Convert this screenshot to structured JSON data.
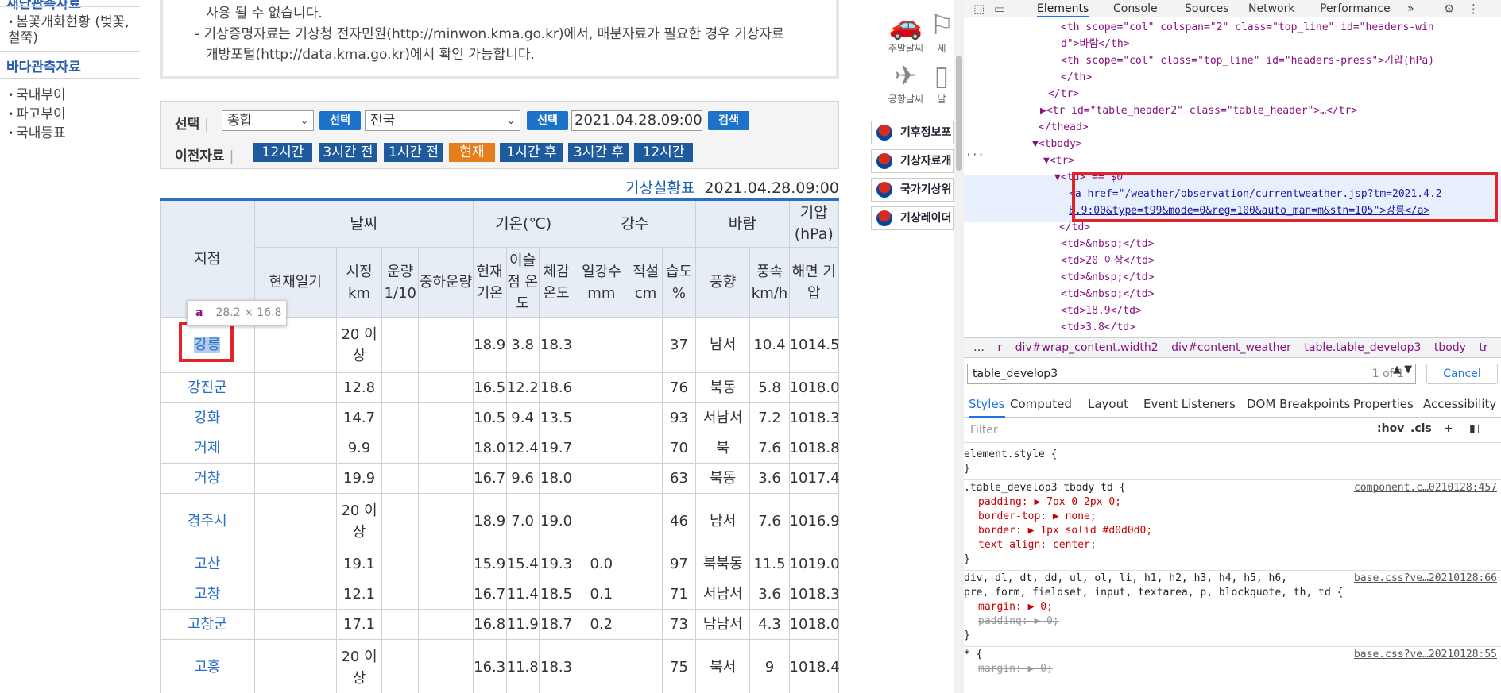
{
  "sidebar": {
    "cut_header": "재난관측자료",
    "items_top": [
      {
        "label": "봄꽃개화현황 (벚꽃, 철쭉)"
      }
    ],
    "section_header": "바다관측자료",
    "items": [
      {
        "label": "국내부이"
      },
      {
        "label": "파고부이"
      },
      {
        "label": "국내등표"
      }
    ]
  },
  "notice": {
    "line1": "사용 될 수 없습니다.",
    "line2": "- 기상증명자료는 기상청 전자민원(http://minwon.kma.go.kr)에서, 매분자료가 필요한 경우 기상자료",
    "line3": "개방포털(http://data.kma.go.kr)에서 확인 가능합니다."
  },
  "selector": {
    "label_select": "선택",
    "label_prev": "이전자료",
    "type_value": "종합",
    "region_value": "전국",
    "select_button": "선택",
    "datetime_value": "2021.04.28.09:00",
    "search_button": "검색",
    "nav_buttons": [
      "12시간",
      "3시간 전",
      "1시간 전",
      "현재",
      "1시간 후",
      "3시간 후",
      "12시간"
    ]
  },
  "table": {
    "title": "기상실황표",
    "datetime": "2021.04.28.09:00",
    "headers": {
      "station": "지점",
      "weather": "날씨",
      "temp": "기온(℃)",
      "precip": "강수",
      "wind": "바람",
      "pressure": "기압(hPa)",
      "sub": [
        "현재일기",
        "시정 km",
        "운량 1/10",
        "중하운량",
        "현재 기온",
        "이슬점 온도",
        "체감 온도",
        "일강수 mm",
        "적설 cm",
        "습도 %",
        "풍향",
        "풍속 km/h",
        "해면 기압"
      ]
    },
    "rows": [
      {
        "station": "강릉",
        "cells": [
          "",
          "20 이상",
          "",
          "",
          "18.9",
          "3.8",
          "18.3",
          "",
          "",
          "37",
          "남서",
          "10.4",
          "1014.5"
        ]
      },
      {
        "station": "강진군",
        "cells": [
          "",
          "12.8",
          "",
          "",
          "16.5",
          "12.2",
          "18.6",
          "",
          "",
          "76",
          "북동",
          "5.8",
          "1018.0"
        ]
      },
      {
        "station": "강화",
        "cells": [
          "",
          "14.7",
          "",
          "",
          "10.5",
          "9.4",
          "13.5",
          "",
          "",
          "93",
          "서남서",
          "7.2",
          "1018.3"
        ]
      },
      {
        "station": "거제",
        "cells": [
          "",
          "9.9",
          "",
          "",
          "18.0",
          "12.4",
          "19.7",
          "",
          "",
          "70",
          "북",
          "7.6",
          "1018.8"
        ]
      },
      {
        "station": "거창",
        "cells": [
          "",
          "19.9",
          "",
          "",
          "16.7",
          "9.6",
          "18.0",
          "",
          "",
          "63",
          "북동",
          "3.6",
          "1017.4"
        ]
      },
      {
        "station": "경주시",
        "cells": [
          "",
          "20 이상",
          "",
          "",
          "18.9",
          "7.0",
          "19.0",
          "",
          "",
          "46",
          "남서",
          "7.6",
          "1016.9"
        ]
      },
      {
        "station": "고산",
        "cells": [
          "",
          "19.1",
          "",
          "",
          "15.9",
          "15.4",
          "19.3",
          "0.0",
          "",
          "97",
          "북북동",
          "11.5",
          "1019.0"
        ]
      },
      {
        "station": "고창",
        "cells": [
          "",
          "12.1",
          "",
          "",
          "16.7",
          "11.4",
          "18.5",
          "0.1",
          "",
          "71",
          "서남서",
          "3.6",
          "1018.3"
        ]
      },
      {
        "station": "고창군",
        "cells": [
          "",
          "17.1",
          "",
          "",
          "16.8",
          "11.9",
          "18.7",
          "0.2",
          "",
          "73",
          "남남서",
          "4.3",
          "1018.0"
        ]
      },
      {
        "station": "고흥",
        "cells": [
          "",
          "20 이상",
          "",
          "",
          "16.3",
          "11.8",
          "18.3",
          "",
          "",
          "75",
          "북서",
          "9",
          "1018.4"
        ]
      }
    ]
  },
  "tooltip": {
    "tag": "a",
    "size": "28.2 × 16.8"
  },
  "quicklinks": {
    "icons": [
      {
        "label": "주말날씨"
      },
      {
        "label": "세"
      },
      {
        "label": "공항날씨"
      },
      {
        "label": "날"
      }
    ],
    "bars": [
      {
        "label": "기후정보포"
      },
      {
        "label": "기상자료개"
      },
      {
        "label": "국가기상위"
      },
      {
        "label": "기상레이더"
      }
    ]
  },
  "devtools": {
    "tabs": [
      "Elements",
      "Console",
      "Sources",
      "Network",
      "Performance",
      "»"
    ],
    "dom": [
      "<th scope=\"col\" colspan=\"2\" class=\"top_line\" id=\"headers-win",
      "d\">바람</th>",
      "<th scope=\"col\" class=\"top_line\" id=\"headers-press\">기압(hPa)",
      "</th>",
      "</tr>",
      "▶<tr id=\"table_header2\" class=\"table_header\">…</tr>",
      "</thead>",
      "▼<tbody>",
      "▼<tr>",
      "▼<td> == $0",
      "<a href=\"/weather/observation/currentweather.jsp?tm=2021.4.2",
      "8.9:00&type=t99&mode=0&reg=100&auto_man=m&stn=105\">강릉</a>",
      "</td>",
      "<td>&nbsp;</td>",
      "<td>20 이상</td>",
      "<td>&nbsp;</td>",
      "<td>&nbsp;</td>",
      "<td>18.9</td>",
      "<td>3.8</td>"
    ],
    "breadcrumb": [
      "…",
      "r",
      "div#wrap_content.width2",
      "div#content_weather",
      "table.table_develop3",
      "tbody",
      "tr",
      "td"
    ],
    "search_value": "table_develop3",
    "search_count": "1 of 1",
    "cancel_label": "Cancel",
    "style_tabs": [
      "Styles",
      "Computed",
      "Layout",
      "Event Listeners",
      "DOM Breakpoints",
      "Properties",
      "Accessibility"
    ],
    "filter_placeholder": "Filter",
    "filter_hov": ":hov",
    "filter_cls": ".cls",
    "css": {
      "r1_selector": "element.style {",
      "r1_close": "}",
      "r2_selector": ".table_develop3 tbody td {",
      "r2_src": "component.c…0210128:457",
      "r2_props": [
        "padding: ▶ 7px 0 2px 0;",
        "border-top: ▶ none;",
        "border: ▶ 1px solid #d0d0d0;",
        "text-align: center;"
      ],
      "r2_close": "}",
      "r3_selector1": "div, dl, dt, dd, ul, ol, li, h1, h2, h3, h4, h5, h6,",
      "r3_selector2": "pre, form, fieldset, input, textarea, p, blockquote, th, td {",
      "r3_src": "base.css?ve…20210128:66",
      "r3_props": [
        "margin: ▶ 0;",
        "padding: ▶ 0;"
      ],
      "r3_close": "}",
      "r4_selector": "* {",
      "r4_src": "base.css?ve…20210128:55",
      "r4_prop": "margin: ▶ 0;"
    }
  }
}
